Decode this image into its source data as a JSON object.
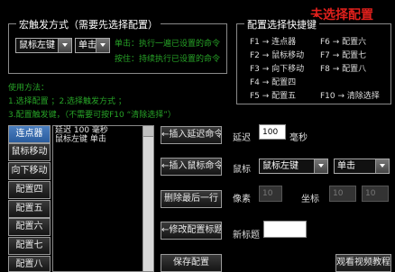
{
  "status_title": "未选择配置",
  "trigger_group": {
    "title": "宏触发方式（需要先选择配置）",
    "mouse_select": "鼠标左键",
    "mode_select": "单击",
    "hint_1": "单击：执行一遍已设置的命令",
    "hint_2": "按住：持续执行已设置的命令"
  },
  "shortcut_group": {
    "title": "配置选择快捷键",
    "items": [
      {
        "key": "F1",
        "action": "连点器"
      },
      {
        "key": "F2",
        "action": "鼠标移动"
      },
      {
        "key": "F3",
        "action": "向下移动"
      },
      {
        "key": "F4",
        "action": "配置四"
      },
      {
        "key": "F5",
        "action": "配置五"
      },
      {
        "key": "F6",
        "action": "配置六"
      },
      {
        "key": "F7",
        "action": "配置七"
      },
      {
        "key": "F8",
        "action": "配置八"
      },
      {
        "key": "F10",
        "action": "清除选择"
      }
    ]
  },
  "usage": {
    "title": "使用方法：",
    "line1": "1.选择配置 ；2.选择触发方式 ；",
    "line2": "3.配置触发键，（不需要可按F10 “清除选择”）"
  },
  "config_list": [
    "连点器",
    "鼠标移动",
    "向下移动",
    "配置四",
    "配置五",
    "配置六",
    "配置七",
    "配置八"
  ],
  "command_list": [
    "延迟 100 毫秒",
    "鼠标左键 单击"
  ],
  "commands": {
    "insert_delay": "←插入延迟命令",
    "insert_mouse": "←插入鼠标命令",
    "delete_last": "删除最后一行",
    "edit_title": "←修改配置标题",
    "save": "保存配置",
    "watch_video": "观看视频教程"
  },
  "params": {
    "delay_label": "延迟",
    "delay_value": "100",
    "delay_unit": "毫秒",
    "mouse_label": "鼠标",
    "mouse_button": "鼠标左键",
    "mouse_action": "单击",
    "pixel_label": "像素",
    "pixel_value": "10",
    "coord_label": "坐标",
    "coord_x": "10",
    "coord_y": "10",
    "new_title_label": "新标题",
    "new_title_value": ""
  },
  "colors": {
    "status_red": "#e0201c",
    "hint_green": "#27a327",
    "active_blue": "#2a5c9d"
  }
}
